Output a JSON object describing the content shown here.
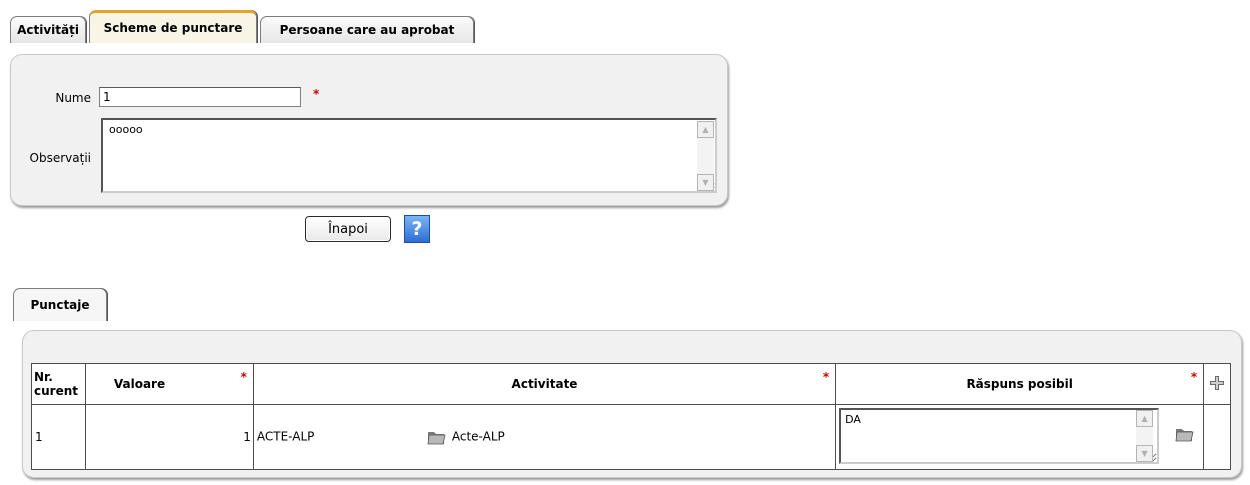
{
  "tabs": [
    {
      "label": "Activități"
    },
    {
      "label": "Scheme de punctare",
      "active": true
    },
    {
      "label": "Persoane care au aprobat"
    }
  ],
  "form": {
    "nume_label": "Nume",
    "nume_value": "1",
    "observatii_label": "Observații",
    "observatii_value": "ooooo",
    "required_mark": "*"
  },
  "buttons": {
    "back_label": "Înapoi",
    "help_label": "?"
  },
  "subtabs": [
    {
      "label": "Punctaje"
    }
  ],
  "grid": {
    "headers": {
      "nr": "Nr. curent",
      "valoare": "Valoare",
      "activitate": "Activitate",
      "raspuns": "Răspuns posibil"
    },
    "rows": [
      {
        "nr": "1",
        "valoare": "1",
        "activitate_code": "ACTE-ALP",
        "activitate_name": "Acte-ALP",
        "raspuns": "DA"
      }
    ]
  },
  "icons": {
    "folder": "folder-icon",
    "add": "plus-icon",
    "help": "help-icon"
  },
  "colors": {
    "active_tab_accent": "#f2b233",
    "required": "#d00000",
    "help_blue": "#2b6fd6"
  }
}
